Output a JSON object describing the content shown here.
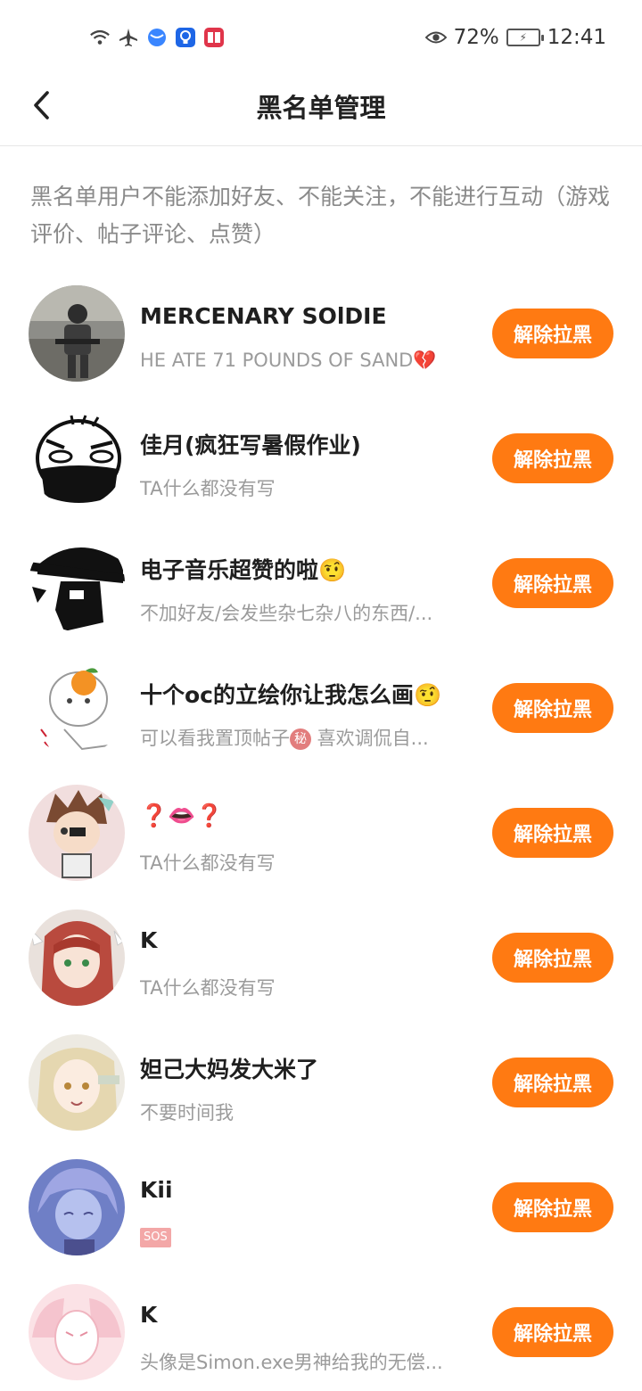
{
  "statusbar": {
    "battery_percent": "72%",
    "time": "12:41",
    "icons": [
      "wifi-icon",
      "airplane-icon",
      "browser-icon",
      "bulb-icon",
      "book-icon",
      "eye-icon",
      "battery-icon"
    ]
  },
  "header": {
    "title": "黑名单管理"
  },
  "notice": "黑名单用户不能添加好友、不能关注，不能进行互动（游戏评价、帖子评论、点赞）",
  "button_label": "解除拉黑",
  "colors": {
    "accent": "#ff7a12",
    "text_primary": "#1f1f1f",
    "text_secondary": "#9b9b9b"
  },
  "users": [
    {
      "name": "MERCENARY SOlDIE",
      "bio": "HE ATE 71 POUNDS OF SAND💔",
      "avatar": "soldier-avatar"
    },
    {
      "name": "佳月(疯狂写暑假作业)",
      "bio": "TA什么都没有写",
      "avatar": "masked-face-avatar"
    },
    {
      "name": "电子音乐超赞的啦🤨",
      "bio": "不加好友/会发些杂七杂八的东西/...",
      "avatar": "hat-silhouette-avatar"
    },
    {
      "name": "十个oc的立绘你让我怎么画🤨",
      "bio_pre": "可以看我置顶帖子",
      "bio_tag": "秘",
      "bio_post": " 喜欢调侃自...",
      "avatar": "orange-head-avatar"
    },
    {
      "name": "❓👄❓",
      "bio": "TA什么都没有写",
      "avatar": "anime-boy-avatar"
    },
    {
      "name": "K",
      "bio": "TA什么都没有写",
      "avatar": "anime-girl-avatar"
    },
    {
      "name": "妲己大妈发大米了",
      "bio": "不要时间我",
      "avatar": "anime-blonde-avatar"
    },
    {
      "name": "Kii",
      "bio_tag_sos": "SOS",
      "avatar": "anime-blue-avatar"
    },
    {
      "name": "K",
      "bio": "头像是Simon.exe男神给我的无偿...",
      "avatar": "anime-pink-avatar"
    }
  ]
}
